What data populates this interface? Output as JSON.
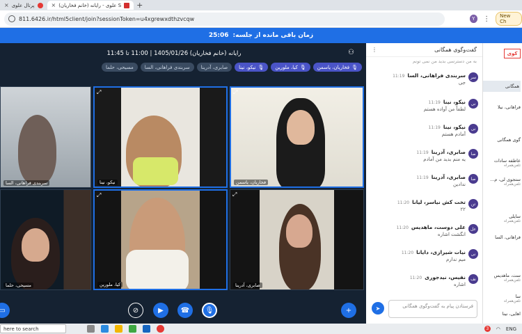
{
  "browser": {
    "tabs": [
      {
        "title": "پرتال علوی",
        "active": false
      },
      {
        "title": "علوی - رایانه (خانم فخاریان) S",
        "active": true
      }
    ],
    "new_tab": "+",
    "url": "811.6426.ir/html5client/join?sessionToken=u4xgrewxdthzvcqw",
    "avatar_letter": "Y",
    "new_chrome": "New Ch"
  },
  "meeting": {
    "timer_label": "زمان باقی مانده از جلسه:",
    "timer_value": "25:06",
    "title": "رایانه (خانم فخاریان) 1405/01/26 | 11:00 تا 11:45",
    "chips": [
      {
        "label": "فخاریان، یاسمن",
        "active": true
      },
      {
        "label": "کیا، ملورین",
        "active": true
      },
      {
        "label": "نیکو، نینا",
        "active": true
      },
      {
        "label": "صابری، آدرینا",
        "active": false
      },
      {
        "label": "سربندی فراهانی، السا",
        "active": false
      },
      {
        "label": "مسیحی، حلما",
        "active": false
      }
    ],
    "tiles": [
      {
        "name": "سربندی فراهانی، السا"
      },
      {
        "name": "نیکو، نینا"
      },
      {
        "name": "فخاریان، یاسمن"
      },
      {
        "name": "مسیحی، حلما"
      },
      {
        "name": "کیا، ملورین"
      },
      {
        "name": "صابری، آدرینا"
      }
    ]
  },
  "chat": {
    "title": "گفت‌وگوی همگانی",
    "truncated_top": "به من دسترسی بدید من نمی تونم",
    "messages": [
      {
        "initials": "سر",
        "sender": "سربندی فراهانی، السا",
        "time": "11:19",
        "text": "جی"
      },
      {
        "initials": "نی",
        "sender": "نیکو، نینا",
        "time": "11:19",
        "text": "لطفاً من آواده هستم"
      },
      {
        "initials": "نی",
        "sender": "نیکو، نینا",
        "time": "11:19",
        "text": "آمادم هستم"
      },
      {
        "initials": "صا",
        "sender": "صابری، آدرینا",
        "time": "11:19",
        "text": "یه منم بدید من آمادم"
      },
      {
        "initials": "صا",
        "sender": "صابری، آدرینا",
        "time": "11:19",
        "text": "ندادین"
      },
      {
        "initials": "تن",
        "sender": "تخت کش نیاسر، لیانا",
        "time": "11:20",
        "text": "۲۲"
      },
      {
        "initials": "عل",
        "sender": "علی دوست، ماهدیس",
        "time": "11:20",
        "text": "انگشت اشاره"
      },
      {
        "initials": "نی",
        "sender": "نیات شیرازی، دایانا",
        "time": "11:20",
        "text": "میم ندارم"
      },
      {
        "initials": "نف",
        "sender": "نفیس، نیدجوری",
        "time": "11:20",
        "text": "اشاره"
      }
    ],
    "input_placeholder": "فرستادن پیام به گفت‌وگوی همگانی"
  },
  "right_panel": {
    "logo": "کوی",
    "items": [
      {
        "title": "همگانی",
        "sub": ""
      },
      {
        "title": "فراهانی، نیلا",
        "sub": ""
      },
      {
        "title": "گوی همگانی",
        "sub": ""
      },
      {
        "title": "عاطفه سادات",
        "sub": "تلفن‌همراه"
      },
      {
        "title": "ستجوی لی، م...",
        "sub": "تلفن‌همراه"
      },
      {
        "title": "سایلی",
        "sub": "تلفن‌همراه"
      },
      {
        "title": "فراهانی، السا",
        "sub": ""
      },
      {
        "title": "ست، ماهدیس",
        "sub": "تلفن‌همراه"
      },
      {
        "title": "سا",
        "sub": "تلفن‌همراه"
      },
      {
        "title": "اهایی، نینا",
        "sub": ""
      }
    ]
  },
  "taskbar": {
    "search": "here to search",
    "lang": "ENG",
    "notif_count": "3"
  },
  "colors": {
    "accent": "#1f6fe5",
    "stage_bg": "#152232",
    "chip_active": "#4a54c7"
  }
}
